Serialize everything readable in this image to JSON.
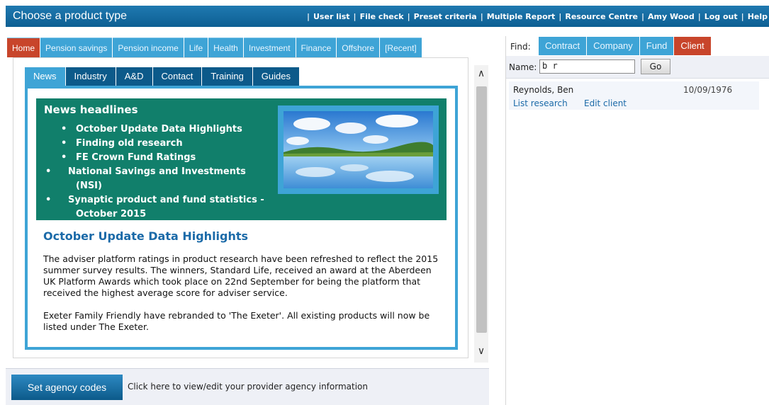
{
  "header": {
    "title": "Choose a product type",
    "nav": [
      "User list",
      "File check",
      "Preset criteria",
      "Multiple Report",
      "Resource Centre",
      "Amy Wood",
      "Log out",
      "Help"
    ]
  },
  "main_tabs": [
    "Home",
    "Pension savings",
    "Pension income",
    "Life",
    "Health",
    "Investment",
    "Finance",
    "Offshore",
    "[Recent]"
  ],
  "sub_tabs": [
    "News",
    "Industry",
    "A&D",
    "Contact",
    "Training",
    "Guides"
  ],
  "news": {
    "headlines_title": "News headlines",
    "headlines": [
      "October Update Data Highlights",
      "Finding old research",
      "FE Crown Fund Ratings",
      "National Savings and Investments (NSI)",
      "Synaptic product and fund statistics - October 2015"
    ],
    "article_title": "October Update Data Highlights",
    "paragraphs": [
      "The adviser platform ratings in product research have been refreshed to reflect the 2015 summer survey results. The winners, Standard Life, received an award at the Aberdeen UK Platform Awards which took place on 22nd September for being the platform that received the highest average score for adviser service.",
      "Exeter Family Friendly have rebranded to 'The Exeter'. All existing products will now be listed under The Exeter."
    ]
  },
  "bottom": {
    "button": "Set agency codes",
    "text": "Click here to view/edit your provider agency information"
  },
  "finder": {
    "find_label": "Find:",
    "tabs": [
      "Contract",
      "Company",
      "Fund",
      "Client"
    ],
    "name_label": "Name:",
    "name_value": "b r",
    "go_label": "Go",
    "result": {
      "name": "Reynolds, Ben",
      "date": "10/09/1976",
      "link1": "List research",
      "link2": "Edit client"
    }
  },
  "colors": {
    "header_blue": "#0d5f93",
    "tab_blue": "#3ea4d6",
    "tab_active_red": "#c8452b",
    "headlines_green": "#117f6b",
    "subtab_navy": "#0c5a8a"
  }
}
